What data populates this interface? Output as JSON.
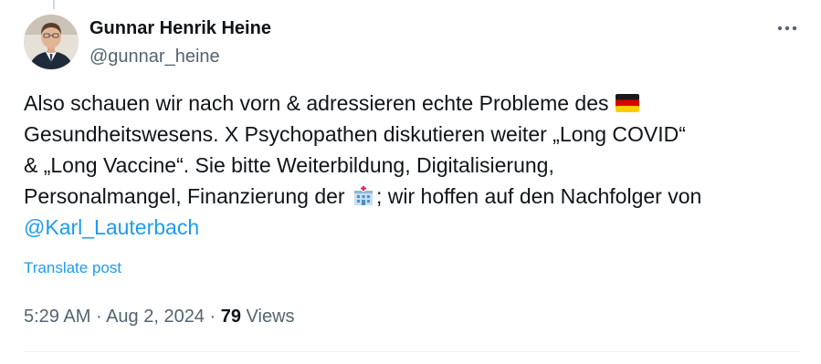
{
  "author": {
    "display_name": "Gunnar Henrik Heine",
    "handle": "@gunnar_heine"
  },
  "post": {
    "text_segments": {
      "l1": "Also schauen wir nach vorn & adressieren echte Probleme des",
      "l2": "Gesundheitswesens. X Psychopathen diskutieren weiter „Long COVID“",
      "l3": "& „Long Vaccine“. Sie bitte Weiterbildung, Digitalisierung,",
      "l4a": "Personalmangel, Finanzierung der",
      "l4b": "; wir hoffen auf den Nachfolger von"
    },
    "mention": "@Karl_Lauterbach",
    "emojis": [
      "germany-flag-icon",
      "hospital-icon"
    ],
    "translate_label": "Translate post"
  },
  "meta": {
    "time": "5:29 AM",
    "separator": " · ",
    "date": "Aug 2, 2024",
    "views_count": "79",
    "views_label": "Views"
  },
  "colors": {
    "text": "#0f1419",
    "secondary": "#536471",
    "link": "#1d9bf0",
    "divider": "#eff3f4"
  }
}
